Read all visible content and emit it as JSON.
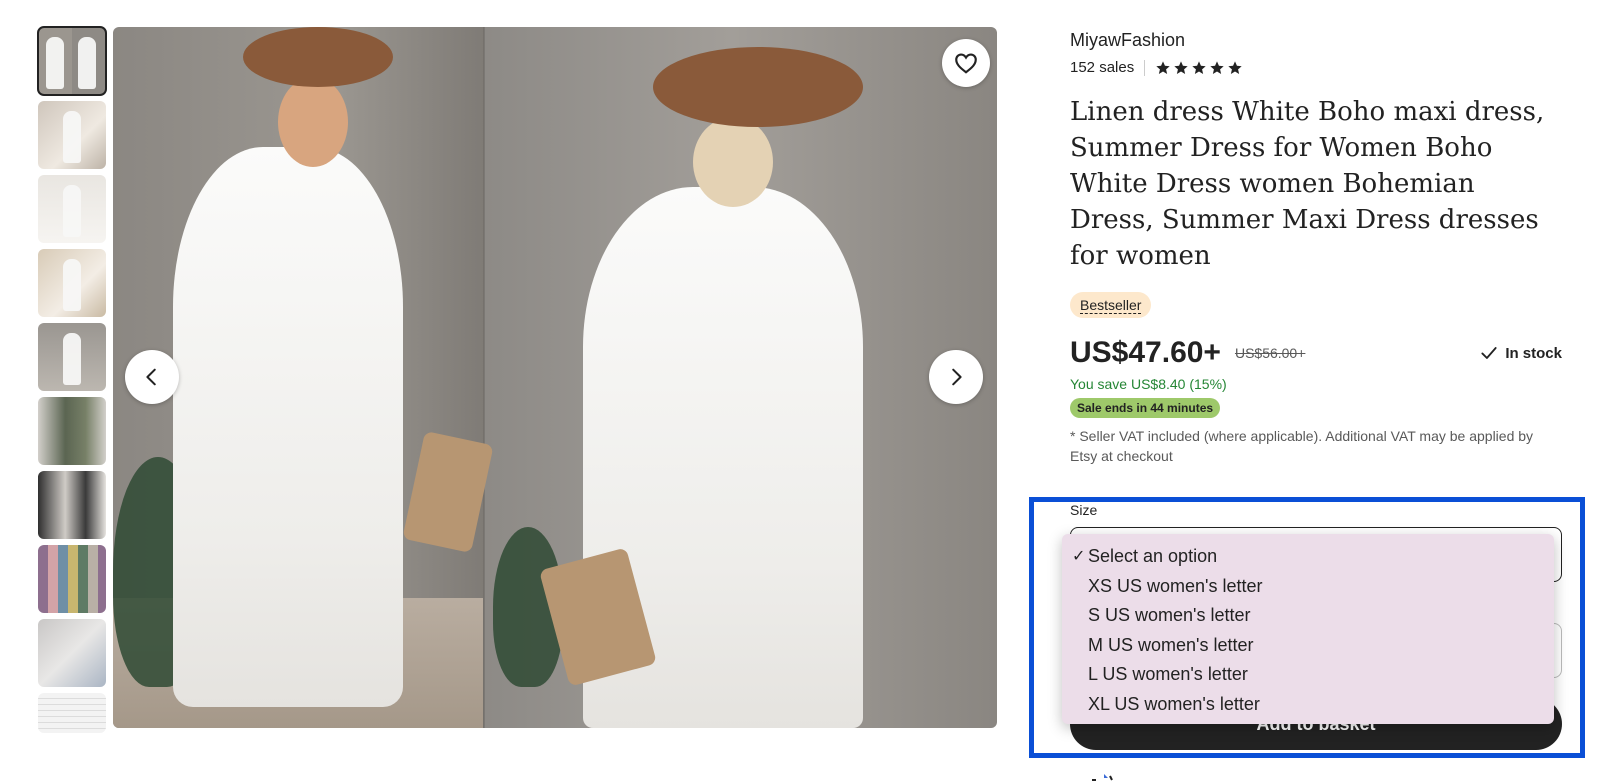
{
  "thumbnails": [
    {
      "name": "thumb-1",
      "active": true
    },
    {
      "name": "thumb-2"
    },
    {
      "name": "thumb-3"
    },
    {
      "name": "thumb-4"
    },
    {
      "name": "thumb-5"
    },
    {
      "name": "thumb-6"
    },
    {
      "name": "thumb-7"
    },
    {
      "name": "thumb-8"
    },
    {
      "name": "thumb-9"
    },
    {
      "name": "thumb-10"
    }
  ],
  "gallery": {
    "prev_icon": "chevron-left-icon",
    "next_icon": "chevron-right-icon",
    "favorite_icon": "heart-icon"
  },
  "shop": {
    "name": "MiyawFashion",
    "sales": "152 sales",
    "rating_stars": 5
  },
  "product": {
    "title": "Linen dress White Boho maxi dress, Summer Dress for Women Boho White Dress women Bohemian Dress, Summer Maxi Dress dresses for women",
    "badge": "Bestseller",
    "price": "US$47.60+",
    "original_price": "US$56.00+",
    "stock": "In stock",
    "savings": "You save US$8.40 (15%)",
    "sale_timer": "Sale ends in 44 minutes",
    "vat_note": "* Seller VAT included (where applicable). Additional VAT may be applied by Etsy at checkout"
  },
  "size": {
    "label": "Size",
    "options": [
      {
        "label": "Select an option",
        "selected": true
      },
      {
        "label": "XS US women's letter"
      },
      {
        "label": "S US women's letter"
      },
      {
        "label": "M US women's letter"
      },
      {
        "label": "L US women's letter"
      },
      {
        "label": "XL US women's letter"
      }
    ]
  },
  "actions": {
    "add_to_basket": "Add to basket"
  },
  "colors": {
    "highlight": "#0a4fd6",
    "sale_green": "#258635",
    "sale_badge": "#9ec96a",
    "bestseller_bg": "#fde8cc",
    "dropdown_bg": "#ecdde9",
    "button_dark": "#222222"
  }
}
